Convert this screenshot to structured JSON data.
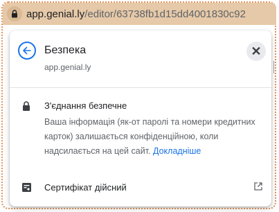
{
  "address_bar": {
    "domain": "app.genial.ly",
    "path": "/editor/63738fb1d15dd4001830c92"
  },
  "popup": {
    "title": "Безпека",
    "subtitle": "app.genial.ly",
    "close_label": "✕",
    "connection": {
      "title": "З'єднання безпечне",
      "description": "Ваша інформація (як-от паролі та номери кредитних карток) залишається конфіденційною, коли надсилається на цей сайт.",
      "learn_more": "Докладніше"
    },
    "certificate": {
      "label": "Сертифікат дійсний"
    }
  },
  "colors": {
    "accent": "#1a73e8",
    "address_bar_bg": "#e6c9a8",
    "frame_border": "#e0935a"
  }
}
